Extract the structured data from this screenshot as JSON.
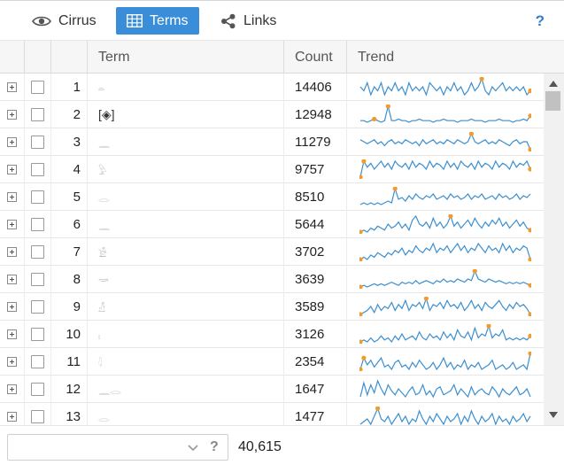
{
  "toolbar": {
    "tabs": [
      {
        "label": "Cirrus",
        "icon": "eye-icon",
        "active": false
      },
      {
        "label": "Terms",
        "icon": "grid-icon",
        "active": true
      },
      {
        "label": "Links",
        "icon": "share-icon",
        "active": false
      }
    ],
    "help_label": "?"
  },
  "columns": {
    "term": "Term",
    "count": "Count",
    "trend": "Trend"
  },
  "rows": [
    {
      "index": "1",
      "term": "𓏏",
      "count": "14406",
      "trend": [
        6,
        5,
        7,
        4,
        6,
        5,
        7,
        4,
        6,
        5,
        7,
        5,
        6,
        4,
        7,
        5,
        6,
        5,
        6,
        4,
        7,
        6,
        5,
        6,
        4,
        6,
        5,
        7,
        5,
        6,
        4,
        5,
        7,
        5,
        6,
        8,
        5,
        4,
        6,
        5,
        6,
        7,
        5,
        6,
        5,
        6,
        5,
        6,
        4,
        5
      ],
      "marks": [
        35,
        49
      ]
    },
    {
      "index": "2",
      "term": "[◈]",
      "count": "12948",
      "trend": [
        3,
        3,
        2,
        3,
        4,
        3,
        2,
        3,
        12,
        3,
        3,
        4,
        3,
        3,
        2,
        3,
        3,
        4,
        3,
        3,
        3,
        2,
        3,
        3,
        4,
        3,
        3,
        3,
        2,
        3,
        3,
        3,
        4,
        3,
        3,
        3,
        2,
        3,
        3,
        3,
        4,
        3,
        3,
        3,
        2,
        3,
        3,
        4,
        3,
        6
      ],
      "marks": [
        4,
        8,
        49
      ]
    },
    {
      "index": "3",
      "term": "𓈖",
      "count": "11279",
      "trend": [
        7,
        6,
        5,
        6,
        7,
        5,
        6,
        4,
        6,
        7,
        5,
        6,
        5,
        7,
        6,
        5,
        6,
        4,
        7,
        5,
        6,
        7,
        5,
        6,
        5,
        7,
        6,
        5,
        7,
        6,
        5,
        6,
        10,
        6,
        5,
        6,
        7,
        5,
        6,
        5,
        7,
        6,
        5,
        4,
        6,
        7,
        5,
        6,
        6,
        2
      ],
      "marks": [
        32,
        49
      ]
    },
    {
      "index": "4",
      "term": "𓅱",
      "count": "9757",
      "trend": [
        1,
        9,
        6,
        8,
        5,
        7,
        9,
        6,
        8,
        5,
        9,
        7,
        6,
        8,
        5,
        9,
        6,
        8,
        7,
        5,
        9,
        6,
        8,
        7,
        5,
        9,
        6,
        8,
        5,
        9,
        7,
        6,
        8,
        5,
        9,
        6,
        8,
        7,
        5,
        9,
        6,
        8,
        7,
        5,
        9,
        6,
        8,
        7,
        9,
        5
      ],
      "marks": [
        0,
        1,
        49
      ]
    },
    {
      "index": "5",
      "term": "𓂋",
      "count": "8510",
      "trend": [
        2,
        3,
        2,
        3,
        2,
        3,
        2,
        3,
        4,
        3,
        11,
        5,
        6,
        4,
        7,
        5,
        8,
        6,
        5,
        7,
        6,
        8,
        5,
        6,
        7,
        5,
        8,
        6,
        7,
        5,
        6,
        8,
        5,
        7,
        6,
        8,
        5,
        6,
        7,
        5,
        8,
        6,
        7,
        5,
        6,
        8,
        5,
        7,
        6,
        8
      ],
      "marks": [
        10
      ]
    },
    {
      "index": "6",
      "term": "𓈖",
      "count": "5644",
      "trend": [
        1,
        2,
        1,
        3,
        2,
        4,
        3,
        2,
        5,
        3,
        4,
        6,
        3,
        5,
        2,
        7,
        9,
        5,
        4,
        6,
        3,
        8,
        4,
        6,
        3,
        5,
        9,
        4,
        6,
        3,
        5,
        7,
        4,
        8,
        5,
        3,
        6,
        4,
        7,
        5,
        8,
        4,
        6,
        3,
        5,
        7,
        4,
        6,
        3,
        2
      ],
      "marks": [
        0,
        26,
        49
      ]
    },
    {
      "index": "7",
      "term": "𓀀",
      "count": "3702",
      "trend": [
        1,
        2,
        1,
        3,
        2,
        4,
        3,
        2,
        4,
        3,
        5,
        4,
        6,
        3,
        5,
        4,
        7,
        5,
        4,
        6,
        5,
        8,
        4,
        6,
        5,
        7,
        4,
        6,
        8,
        5,
        7,
        4,
        6,
        5,
        8,
        6,
        4,
        7,
        5,
        6,
        4,
        8,
        5,
        7,
        4,
        6,
        5,
        7,
        6,
        1
      ],
      "marks": [
        0,
        49
      ]
    },
    {
      "index": "8",
      "term": "𓎡",
      "count": "3639",
      "trend": [
        1,
        2,
        1,
        2,
        3,
        2,
        3,
        2,
        3,
        4,
        3,
        2,
        4,
        3,
        4,
        3,
        5,
        3,
        4,
        5,
        4,
        3,
        5,
        4,
        6,
        4,
        5,
        4,
        6,
        5,
        4,
        6,
        5,
        11,
        6,
        5,
        4,
        6,
        5,
        4,
        5,
        4,
        3,
        4,
        3,
        4,
        3,
        4,
        3,
        2
      ],
      "marks": [
        0,
        33,
        49
      ]
    },
    {
      "index": "9",
      "term": "𓀭",
      "count": "3589",
      "trend": [
        1,
        2,
        3,
        5,
        2,
        6,
        3,
        5,
        4,
        7,
        3,
        6,
        4,
        8,
        3,
        6,
        5,
        7,
        4,
        9,
        3,
        6,
        5,
        7,
        4,
        8,
        5,
        6,
        4,
        7,
        3,
        5,
        8,
        4,
        6,
        3,
        7,
        5,
        4,
        6,
        8,
        5,
        3,
        6,
        4,
        7,
        5,
        6,
        4,
        1
      ],
      "marks": [
        0,
        19,
        49
      ]
    },
    {
      "index": "10",
      "term": "𓏤",
      "count": "3126",
      "trend": [
        1,
        2,
        1,
        3,
        1,
        2,
        4,
        2,
        3,
        1,
        4,
        2,
        5,
        2,
        3,
        4,
        2,
        6,
        3,
        2,
        5,
        3,
        4,
        2,
        6,
        3,
        5,
        2,
        7,
        4,
        3,
        6,
        2,
        8,
        3,
        5,
        4,
        9,
        3,
        5,
        4,
        7,
        2,
        3,
        2,
        3,
        2,
        3,
        2,
        4
      ],
      "marks": [
        0,
        37,
        49
      ]
    },
    {
      "index": "11",
      "term": "𓇋",
      "count": "2354",
      "trend": [
        4,
        9,
        6,
        8,
        5,
        7,
        9,
        5,
        6,
        4,
        7,
        8,
        5,
        6,
        4,
        7,
        5,
        8,
        6,
        4,
        5,
        7,
        4,
        6,
        9,
        5,
        7,
        4,
        6,
        5,
        8,
        4,
        6,
        5,
        7,
        4,
        5,
        6,
        8,
        4,
        5,
        6,
        4,
        5,
        7,
        4,
        5,
        6,
        4,
        11
      ],
      "marks": [
        0,
        1,
        49
      ]
    },
    {
      "index": "12",
      "term": "𓈖𓂋",
      "count": "1647",
      "trend": [
        2,
        9,
        3,
        8,
        4,
        10,
        6,
        3,
        8,
        5,
        3,
        6,
        4,
        2,
        5,
        7,
        3,
        4,
        8,
        3,
        5,
        2,
        6,
        7,
        3,
        4,
        5,
        8,
        3,
        6,
        4,
        2,
        7,
        3,
        5,
        6,
        4,
        3,
        7,
        5,
        2,
        6,
        4,
        3,
        5,
        7,
        3,
        4,
        6,
        2
      ],
      "marks": []
    },
    {
      "index": "13",
      "term": "𓂋",
      "count": "1477",
      "trend": [
        3,
        4,
        5,
        3,
        6,
        9,
        5,
        4,
        6,
        3,
        5,
        7,
        4,
        6,
        3,
        5,
        4,
        8,
        5,
        3,
        6,
        4,
        7,
        5,
        3,
        6,
        4,
        5,
        7,
        3,
        6,
        4,
        8,
        5,
        3,
        6,
        4,
        5,
        7,
        3,
        6,
        4,
        5,
        3,
        6,
        4,
        5,
        7,
        4,
        6
      ],
      "marks": [
        5
      ]
    }
  ],
  "footer": {
    "search_placeholder": "",
    "help_label": "?",
    "total": "40,615"
  },
  "colors": {
    "accent": "#3a8ed9",
    "sparkline": "#3c8fd0",
    "marker": "#f39a2b"
  }
}
